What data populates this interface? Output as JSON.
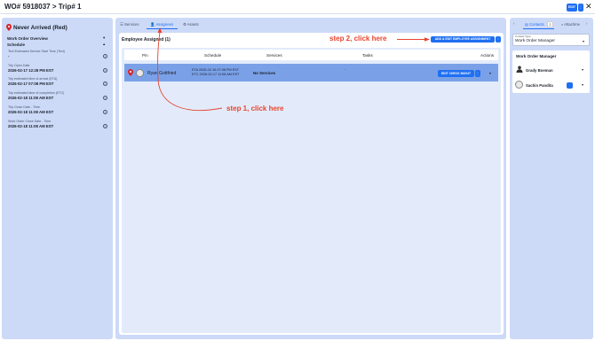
{
  "header": {
    "title": "WO# 5918037 > Trip# 1",
    "edit_label": "EDIT",
    "more_label": "⋮",
    "close_label": "✕"
  },
  "left": {
    "status": "Never Arrived (Red)",
    "overview_label": "Work Order Overview",
    "schedule_label": "Schedule",
    "fields": [
      {
        "label": "Text Estimated Service Start Time (Text)",
        "value": "-"
      },
      {
        "label": "Trip Open Date",
        "value": "2026-02-17 12:28 PM EST"
      },
      {
        "label": "Trip estimated time of arrival (ETA)",
        "value": "2026-02-17 07:08 PM EST"
      },
      {
        "label": "Trip estimated time of completion (ETC)",
        "value": "2026-02-18 11:08 AM EST"
      },
      {
        "label": "Trip Close Date - Time",
        "value": "2026-02-18 11:08 AM EST"
      },
      {
        "label": "Work Order Close Date - Time",
        "value": "2026-02-18 11:08 AM EST"
      }
    ]
  },
  "tabs": {
    "services": "Services",
    "assignees": "Assignees",
    "assets": "Assets"
  },
  "assignees": {
    "heading": "Employee Assigned (1)",
    "add_label": "ADD & EDIT EMPLOYEE ASSIGNMENT",
    "more_label": "⋮",
    "columns": [
      "Pin",
      "Schedule",
      "Services",
      "Tasks",
      "Actions"
    ],
    "row": {
      "name": "Ryan Gottfried",
      "eta": "ETA 2026-02-16 07:08 PM EST",
      "etc": "ETC 2026-02-17 11:08 AM EST",
      "services": "No Services",
      "tasks": "-",
      "check_label": "EDIT CHECK IN/OUT",
      "check_more": "⋮"
    }
  },
  "callouts": {
    "step1": "step 1, click here",
    "step2": "step 2, click here"
  },
  "right": {
    "contacts_label": "Contacts",
    "contacts_count": "2",
    "attachments_label": "Attachme",
    "contact_type_label": "Contact Type",
    "contact_type_value": "Work Order Manager",
    "section_title": "Work Order Manager",
    "contacts": [
      {
        "name": "Grady Boeman"
      },
      {
        "name": "Sachin Pandita"
      }
    ]
  },
  "colors": {
    "accent": "#1f6ff2",
    "panel": "#ccdaf8",
    "callout": "#e8442f",
    "row_highlight": "#7aa1e8"
  }
}
